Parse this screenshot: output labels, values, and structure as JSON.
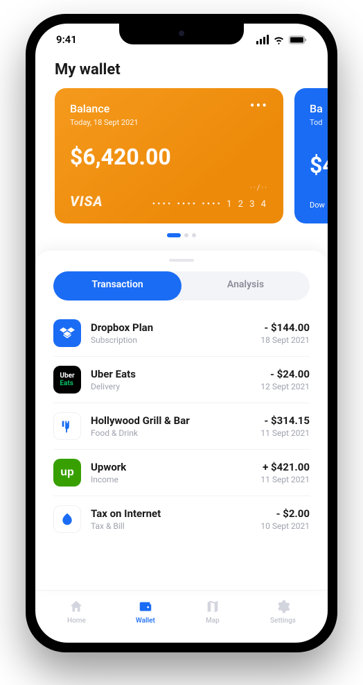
{
  "status": {
    "time": "9:41"
  },
  "header": {
    "title": "My wallet"
  },
  "cards": [
    {
      "label": "Balance",
      "date": "Today, 18 Sept 2021",
      "amount": "$6,420.00",
      "brand": "VISA",
      "expiry": "··/··",
      "number": "•••• •••• ••••  1 2 3 4",
      "color": "orange"
    },
    {
      "label": "Ba",
      "date": "Tod",
      "amount": "$4",
      "brand": "",
      "expiry": "",
      "number": "Dow",
      "color": "blue"
    }
  ],
  "tabs": {
    "active": "Transaction",
    "inactive": "Analysis"
  },
  "transactions": [
    {
      "title": "Dropbox Plan",
      "category": "Subscription",
      "amount": "- $144.00",
      "date": "18 Sept 2021",
      "iconBg": "#1a6cf4",
      "icon": "dropbox"
    },
    {
      "title": "Uber Eats",
      "category": "Delivery",
      "amount": "- $24.00",
      "date": "12 Sept 2021",
      "iconBg": "#000000",
      "icon": "ubereats"
    },
    {
      "title": "Hollywood Grill & Bar",
      "category": "Food & Drink",
      "amount": "- $314.15",
      "date": "11 Sept 2021",
      "iconBg": "#ffffff",
      "icon": "restaurant"
    },
    {
      "title": "Upwork",
      "category": "Income",
      "amount": "+ $421.00",
      "date": "11 Sept 2021",
      "iconBg": "#37a000",
      "icon": "upwork"
    },
    {
      "title": "Tax on Internet",
      "category": "Tax & Bill",
      "amount": "- $2.00",
      "date": "10 Sept 2021",
      "iconBg": "#ffffff",
      "icon": "leaf"
    }
  ],
  "nav": {
    "home": "Home",
    "wallet": "Wallet",
    "map": "Map",
    "settings": "Settings"
  }
}
